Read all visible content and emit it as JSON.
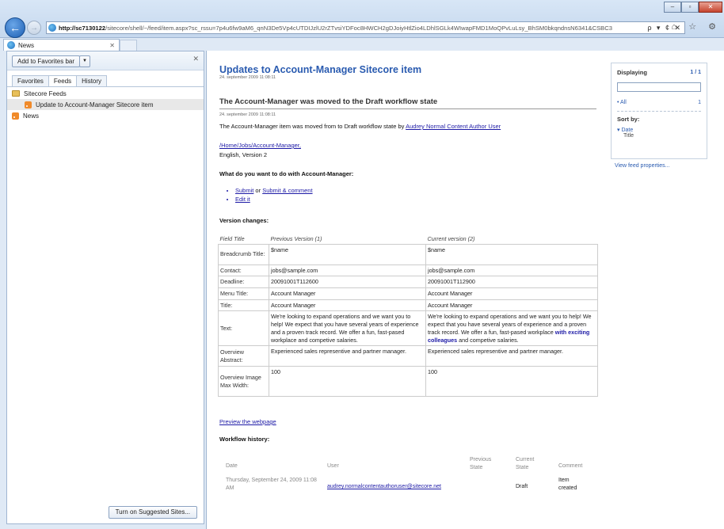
{
  "browser": {
    "url_host": "http://sc7130122",
    "url_rest": "/sitecore/shell/~/feed/item.aspx?sc_rssu=7p4u6fw9aM6_qnN3De5Vp4cUTDIJzlU2rZTvsiYDFoc8HWCH2gDJoiyHtlZio4LDhlSGLk4WIwapFMD1MoQPvLuLsy_BhSM0bkqndnsN6341&CSBC3",
    "url_tools": "ρ ▾ ¢ ✕",
    "tab_label": "News",
    "tab_close": "✕",
    "back_icon": "back-arrow-icon",
    "forward_icon": "forward-arrow-icon",
    "right_tools": "⌂ ☆ ⚙",
    "window_buttons": [
      "–",
      "▫",
      "✕"
    ]
  },
  "favorites_pane": {
    "add_button": "Add to Favorites bar",
    "add_drop": "▼",
    "close": "✕",
    "tabs": [
      "Favorites",
      "Feeds",
      "History"
    ],
    "tree": [
      {
        "label": "Sitecore Feeds",
        "icon": "folder-icon"
      },
      {
        "label": "Update to Account-Manager Sitecore item",
        "icon": "rss-icon",
        "selected": true
      },
      {
        "label": "News",
        "icon": "rss-icon"
      }
    ],
    "suggest_button": "Turn on Suggested Sites..."
  },
  "feed": {
    "title": "Updates to Account-Manager Sitecore item",
    "date": "24. september 2009 11:08:11"
  },
  "item": {
    "title": "The Account-Manager was moved to the Draft workflow state",
    "date": "24. september 2009 11:08:11",
    "moved_text": "The Account-Manager item was moved from to Draft workflow state by ",
    "moved_user": "Audrey Normal Content Author User",
    "path_link": "/Home/Jobs/Account-Manager,",
    "lang_version": "English, Version 2",
    "question": "What do you want to do with Account-Manager:",
    "action_submit": "Submit",
    "action_or": " or ",
    "action_submit_comment": "Submit & comment",
    "action_edit": "Edit it",
    "version_changes": "Version changes:",
    "table_headers": [
      "Field Title",
      "Previous Version (1)",
      "Current version (2)"
    ],
    "rows": [
      {
        "field": "Breadcrumb Title:",
        "prev": "$name",
        "curr": "$name"
      },
      {
        "field": "Contact:",
        "prev": "jobs@sample.com",
        "curr": "jobs@sample.com"
      },
      {
        "field": "Deadline:",
        "prev": "20091001T112600",
        "curr": "20091001T112900"
      },
      {
        "field": "Menu Title:",
        "prev": "Account Manager",
        "curr": "Account Manager"
      },
      {
        "field": "Title:",
        "prev": "Account Manager",
        "curr": "Account Manager"
      },
      {
        "field": "Text:",
        "prev": "We're looking to expand operations and we want you to help! We expect that you have several years of experience and a proven track record. We offer a fun, fast-pased workplace and competive salaries.",
        "curr_before": "We're looking to expand operations and we want you to help! We expect that you have several years of experience and a proven track record. We offer a fun, fast-pased workplace ",
        "curr_highlight": "with exciting colleagues",
        "curr_after": " and competive salaries."
      },
      {
        "field": "Overview Abstract:",
        "prev": "Experienced sales representive and partner manager.",
        "curr": "Experienced sales representive and partner manager."
      },
      {
        "field": "Overview Image Max Width:",
        "prev": "100",
        "curr": "100"
      }
    ],
    "preview_link": "Preview the webpage",
    "workflow_history": "Workflow history:",
    "wf_headers": {
      "date": "Date",
      "user": "User",
      "prev_state": "Previous State",
      "curr_state": "Current State",
      "comment": "Comment"
    },
    "wf_row": {
      "date": "Thursday, September 24, 2009 11:08 AM",
      "user": "audrey.normalcontentauthoruser@sitecore.net",
      "prev_state": "",
      "curr_state": "Draft",
      "comment": "Item created"
    }
  },
  "displaying": {
    "heading": "Displaying",
    "count": "1 / 1",
    "all_label": "• All",
    "all_count": "1",
    "sort_by": "Sort by:",
    "sort_date": "▾ Date",
    "sort_title": "Title",
    "view_props": "View feed properties..."
  }
}
